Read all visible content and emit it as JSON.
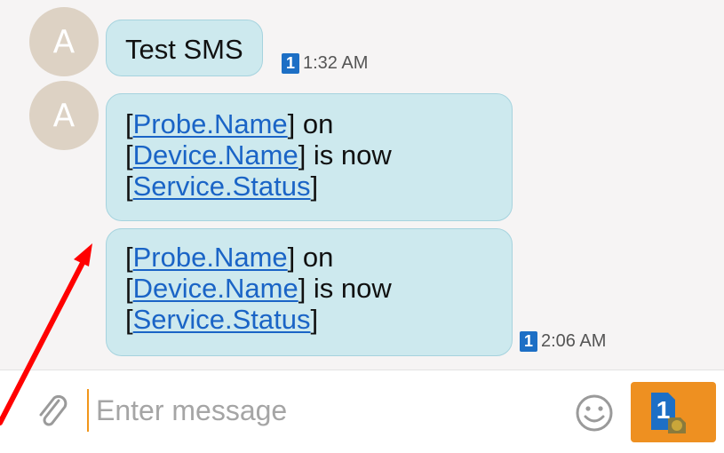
{
  "messages": [
    {
      "avatar_letter": "A",
      "lines": [
        [
          {
            "t": "Test SMS",
            "link": false
          }
        ]
      ],
      "sim": "1",
      "time": "1:32 AM"
    },
    {
      "avatar_letter": "A",
      "lines": [
        [
          {
            "t": "[",
            "link": false
          },
          {
            "t": "Probe.Name",
            "link": true
          },
          {
            "t": "] on",
            "link": false
          }
        ],
        [
          {
            "t": "[",
            "link": false
          },
          {
            "t": "Device.Name",
            "link": true
          },
          {
            "t": "] is now",
            "link": false
          }
        ],
        [
          {
            "t": "[",
            "link": false
          },
          {
            "t": "Service.Status",
            "link": true
          },
          {
            "t": "]",
            "link": false
          }
        ]
      ]
    },
    {
      "lines": [
        [
          {
            "t": "[",
            "link": false
          },
          {
            "t": "Probe.Name",
            "link": true
          },
          {
            "t": "] on",
            "link": false
          }
        ],
        [
          {
            "t": "[",
            "link": false
          },
          {
            "t": "Device.Name",
            "link": true
          },
          {
            "t": "] is now",
            "link": false
          }
        ],
        [
          {
            "t": "[",
            "link": false
          },
          {
            "t": "Service.Status",
            "link": true
          },
          {
            "t": "]",
            "link": false
          }
        ]
      ],
      "sim": "1",
      "time": "2:06 AM"
    }
  ],
  "composer": {
    "placeholder": "Enter message",
    "attach_icon": "paperclip-icon",
    "emoji_icon": "smiley-icon",
    "send_sim": "1",
    "send_icon": "sim-card-icon"
  },
  "annotation": {
    "color": "#ff0000"
  },
  "colors": {
    "bubble": "#cde9ee",
    "link": "#1a64c6",
    "send_button": "#ee9021",
    "avatar": "#ddd2c4",
    "sim_badge": "#1d6fc5"
  }
}
